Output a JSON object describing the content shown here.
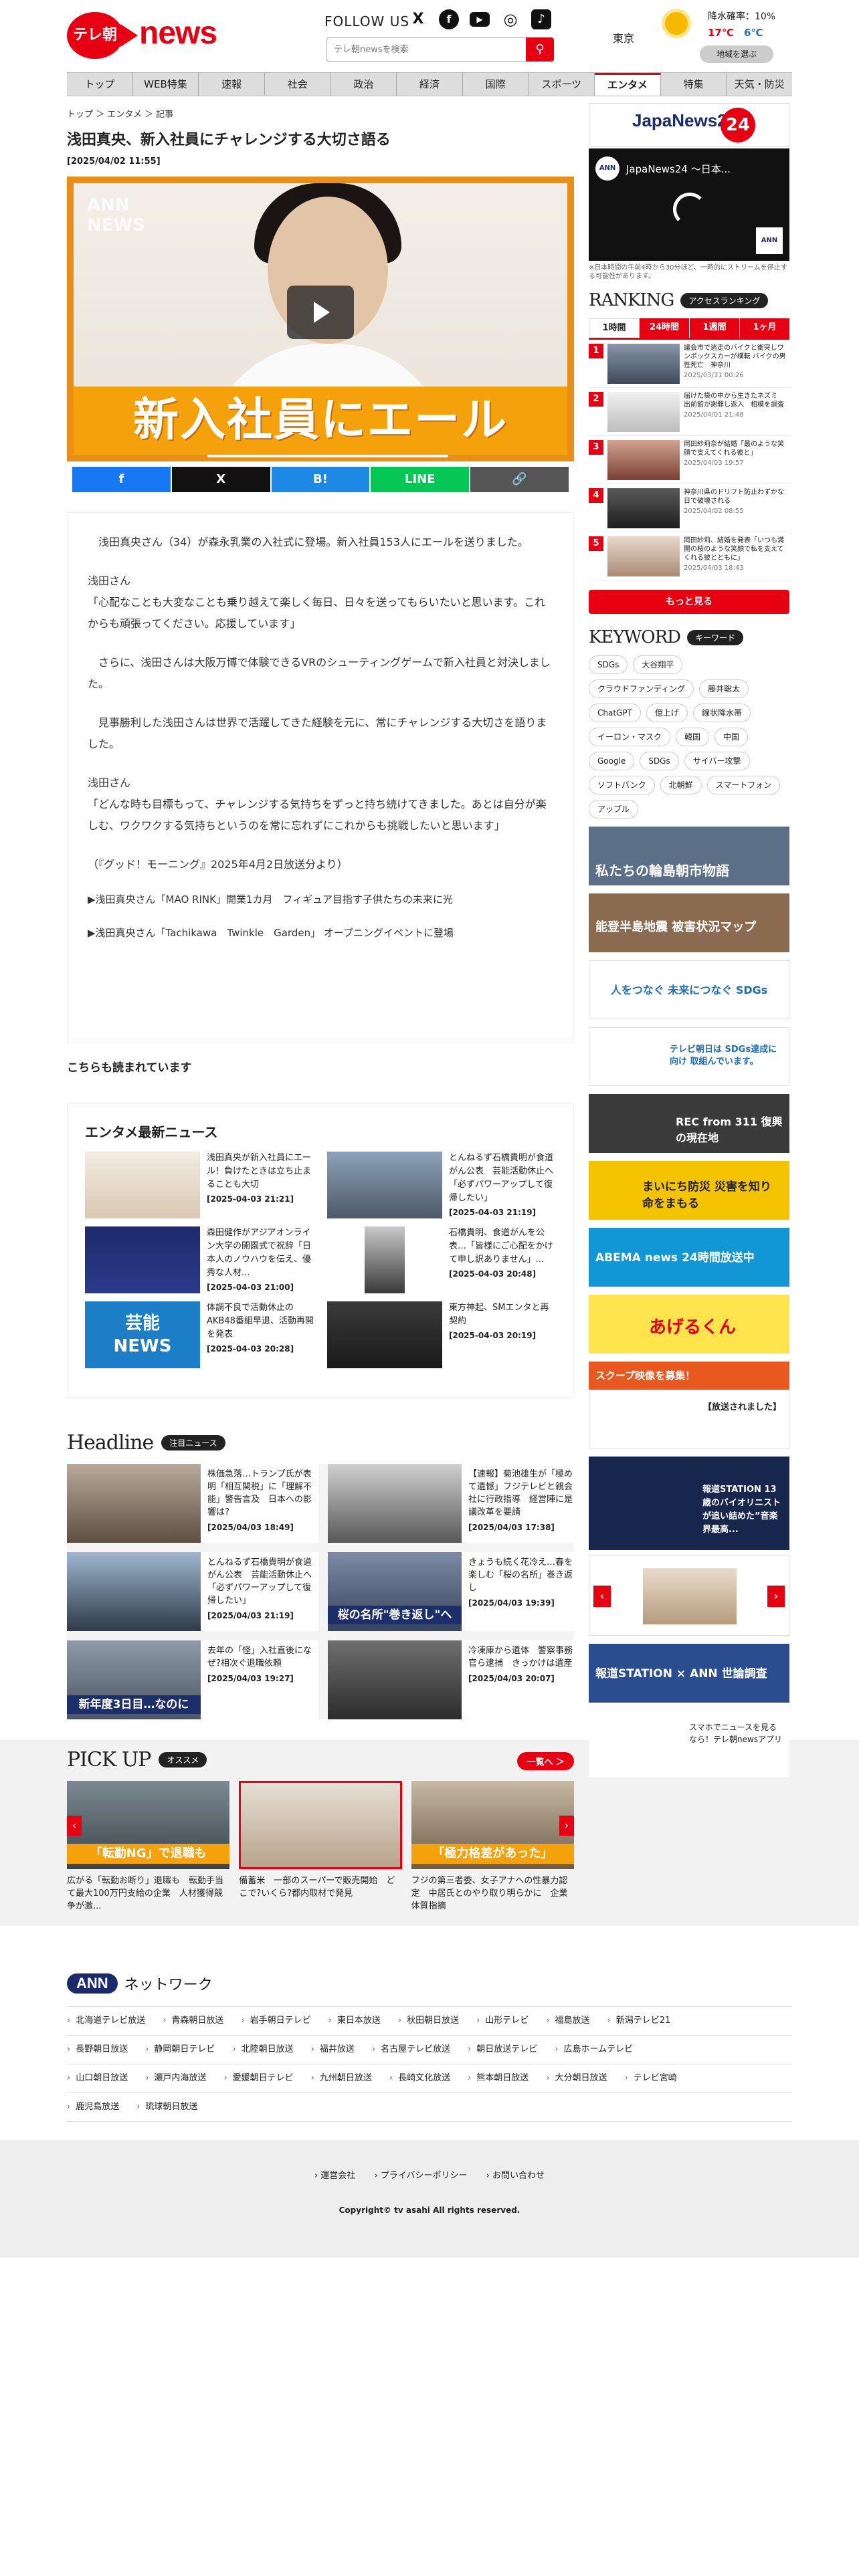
{
  "header": {
    "logo_circle": "テレ朝",
    "logo_word": "news",
    "follow_us": "FOLLOW US",
    "sns": [
      "X",
      "f",
      "▶",
      "◎",
      "♪"
    ],
    "search_placeholder": "テレ朝newsを検索",
    "weather": {
      "city": "東京",
      "rain_label": "降水確率：10%",
      "high": "17℃",
      "low": "6℃",
      "region_button": "地域を選ぶ"
    }
  },
  "nav": [
    "トップ",
    "WEB特集",
    "速報",
    "社会",
    "政治",
    "経済",
    "国際",
    "スポーツ",
    "エンタメ",
    "特集",
    "天気・防災"
  ],
  "breadcrumb": "トップ ＞ エンタメ ＞ 記事",
  "article": {
    "title": "浅田真央、新入社員にチャレンジする大切さ語る",
    "date": "[2025/04/02 11:55]",
    "video_caption": "新入社員にエール",
    "video_ann": "ANN\nNEWS",
    "paragraphs": [
      "　浅田真央さん（34）が森永乳業の入社式に登場。新入社員153人にエールを送りました。",
      "浅田さん\n「心配なことも大変なことも乗り越えて楽しく毎日、日々を送ってもらいたいと思います。これからも頑張ってください。応援しています」",
      "　さらに、浅田さんは大阪万博で体験できるVRのシューティングゲームで新入社員と対決しました。",
      "　見事勝利した浅田さんは世界で活躍してきた経験を元に、常にチャレンジする大切さを語りました。",
      "浅田さん\n「どんな時も目標もって、チャレンジする気持ちをずっと持ち続けてきました。あとは自分が楽しむ、ワクワクする気持ちというのを常に忘れずにこれからも挑戦したいと思います」",
      "（『グッド！モーニング』2025年4月2日放送分より）"
    ],
    "links": [
      "▶浅田真央さん「MAO RINK」開業1カ月　フィギュア目指す子供たちの未来に光",
      "▶浅田真央さん「Tachikawa　Twinkle　Garden」 オープニングイベントに登場"
    ]
  },
  "related_heading": "こちらも読まれています",
  "entame": {
    "heading": "エンタメ最新ニュース",
    "items": [
      {
        "title": "浅田真央が新入社員にエール！負けたときは立ち止まることも大切",
        "date": "[2025-04-03 21:21]"
      },
      {
        "title": "とんねるず石橋貴明が食道がん公表　芸能活動休止へ「必ずパワーアップして復帰したい」",
        "date": "[2025-04-03 21:19]"
      },
      {
        "title": "森田健作がアジアオンライン大学の開園式で祝辞「日本人のノウハウを伝え、優秀な人材...",
        "date": "[2025-04-03 21:00]"
      },
      {
        "title": "石橋貴明、食道がんを公表…「皆様にご心配をかけて申し訳ありません」...",
        "date": "[2025-04-03 20:48]"
      },
      {
        "title": "体調不良で活動休止のAKB48番組早退、活動再開を発表",
        "date": "[2025-04-03 20:28]"
      },
      {
        "title": "東方神起、SMエンタと再契約",
        "date": "[2025-04-03 20:19]"
      }
    ],
    "thumb3_label": "芸能\nNEWS"
  },
  "headline": {
    "heading": "Headline",
    "pill": "注目ニュース",
    "items": [
      {
        "title": "株価急落…トランプ氏が表明「相互関税」に「理解不能」警告言及　日本への影響は?",
        "date": "[2025/04/03 18:49]"
      },
      {
        "title": "【速報】菊池雄生が「極めて遺憾」フジテレビと親会社に行政指導　経営陣に是議改革を要請",
        "date": "[2025/04/03 17:38]"
      },
      {
        "title": "とんねるず石橋貴明が食道がん公表　芸能活動休止へ「必ずパワーアップして復帰したい」",
        "date": "[2025/04/03 21:19]"
      },
      {
        "title": "きょうも続く花冷え…春を楽しむ「桜の名所」巻き返し",
        "date": "[2025/04/03 19:39]"
      },
      {
        "title": "去年の「怪」入社直後になぜ?相次ぐ退職依頼",
        "date": "[2025/04/03 19:27]"
      },
      {
        "title": "冷凍庫から遺体　警察事務官ら逮捕　きっかけは遺産",
        "date": "[2025/04/03 20:07]"
      }
    ],
    "overlay2": "桜の名所\"巻き返し\"へ",
    "overlay4": "新年度3日目…なのに"
  },
  "pickup": {
    "heading": "PICK UP",
    "pill": "オススメ",
    "all_button": "一覧へ ＞",
    "items": [
      {
        "title": "広がる「転勤お断り」退職も　転勤手当て最大100万円支給の企業　人材獲得競争が激...",
        "overlay": "「転勤NG」で退職も"
      },
      {
        "title": "備蓄米　一部のスーパーで販売開始　どこで?いくら?都内取材で発見",
        "overlay": ""
      },
      {
        "title": "フジの第三者委、女子アナへの性暴力認定　中居氏とのやり取り明らかに　企業体質指摘",
        "overlay": "「極力格差があった」"
      }
    ]
  },
  "sidebar": {
    "jn24_title": "JapaNews24",
    "jn24_video_title": "JapaNews24 〜日本...",
    "jn24_note": "※日本時間の午前4時から30分ほど、一時的にストリームを停止する可能性があります。",
    "ranking_title": "RANKING",
    "ranking_pill": "アクセスランキング",
    "ranking_tabs": [
      "1時間",
      "24時間",
      "1週間",
      "1ヶ月"
    ],
    "ranking": [
      {
        "num": "1",
        "title": "議会市で逃走のバイクと衝突しワンボックスカーが横転 バイクの男性死亡　神奈川",
        "date": "2025/03/31 00:26"
      },
      {
        "num": "2",
        "title": "届けた袋の中から生きたネズミ　出前館が謝罪し返入　相模を調査",
        "date": "2025/04/01 21:48"
      },
      {
        "num": "3",
        "title": "岡田紗莉奈が結婚「最のような笑顔で支えてくれる彼と」",
        "date": "2025/04/03 19:57"
      },
      {
        "num": "4",
        "title": "神奈川県のドリフト防止わずかな日で破壊される",
        "date": "2025/04/02 08:55"
      },
      {
        "num": "5",
        "title": "岡田紗莉、結婚を発表「いつも満開の桜のような笑顔で私を支えてくれる彼とともに」",
        "date": "2025/04/03 18:43"
      }
    ],
    "ranking_more": "もっと見る",
    "keyword_title": "KEYWORD",
    "keyword_pill": "キーワード",
    "keywords": [
      "SDGs",
      "大谷翔平",
      "クラウドファンディング",
      "藤井聡太",
      "ChatGPT",
      "億上げ",
      "線状降水帯",
      "イーロン・マスク",
      "韓国",
      "中国",
      "Google",
      "SDGs",
      "サイバー攻撃",
      "ソフトバンク",
      "北朝鮮",
      "スマートフォン",
      "アップル"
    ],
    "banners": [
      {
        "text": "私たちの輪島朝市物語",
        "bg": "#5b6f87"
      },
      {
        "text": "能登半島地震 被害状況マップ",
        "bg": "#8a6b4f"
      },
      {
        "text": "人をつなぐ 未来につなぐ SDGs",
        "bg": "#ffffff"
      },
      {
        "text": "テレビ朝日は SDGs達成に向け 取組んでいます。",
        "bg": "#ffffff"
      },
      {
        "text": "REC from 311 復興の現在地",
        "bg": "#3a3a3a"
      },
      {
        "text": "まいにち防災 災害を知り 命をまもる",
        "bg": "#f5c400"
      },
      {
        "text": "ABEMA news 24時間放送中",
        "bg": "#1296d6"
      },
      {
        "text": "あげるくん",
        "bg": "#ffe44d"
      },
      {
        "text": "スクープ映像を募集！",
        "bg": "#e8581f"
      },
      {
        "text": "【放送されました】",
        "bg": "#ffffff"
      },
      {
        "text": "報道STATION 13歳のバイオリニストが追い詰めた”音楽界最高...",
        "bg": "#16264d"
      },
      {
        "text": "報道STATION × ANN 世論調査",
        "bg": "#2a4d8f"
      },
      {
        "text": "スマホでニュースを見るなら！テレ朝newsアプリ",
        "bg": "#ffffff"
      }
    ]
  },
  "network": {
    "badge": "ANN",
    "heading": "ネットワーク",
    "stations": [
      "北海道テレビ放送",
      "青森朝日放送",
      "岩手朝日テレビ",
      "東日本放送",
      "秋田朝日放送",
      "山形テレビ",
      "福島放送",
      "新潟テレビ21",
      "長野朝日放送",
      "静岡朝日テレビ",
      "北陸朝日放送",
      "福井放送",
      "名古屋テレビ放送",
      "朝日放送テレビ",
      "広島ホームテレビ",
      "山口朝日放送",
      "瀬戸内海放送",
      "愛媛朝日テレビ",
      "九州朝日放送",
      "長崎文化放送",
      "熊本朝日放送",
      "大分朝日放送",
      "テレビ宮崎",
      "鹿児島放送",
      "琉球朝日放送"
    ]
  },
  "footer": {
    "links": [
      "› 運営会社",
      "› プライバシーポリシー",
      "› お問い合わせ"
    ],
    "copyright": "Copyright© tv asahi All rights reserved."
  },
  "colors": {
    "brand_red": "#e60012",
    "accent_orange": "#f5a10c",
    "ann_navy": "#1b2a6b"
  }
}
